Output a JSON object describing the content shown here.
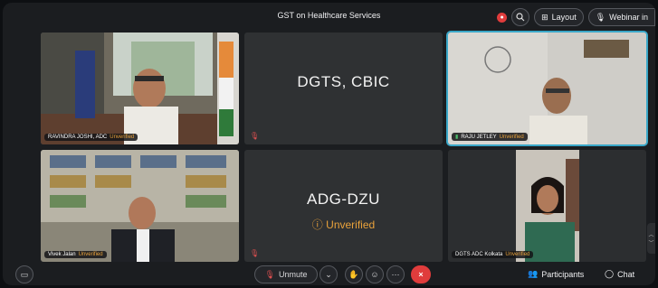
{
  "window": {
    "title": "GST on Healthcare Services"
  },
  "topbar": {
    "layout_label": "Layout",
    "webinar_label": "Webinar in"
  },
  "tiles": [
    {
      "id": "t1",
      "name": "RAVINDRA JOSHI, ADC",
      "status": "Unverified",
      "type": "video"
    },
    {
      "id": "t2",
      "label": "DGTS, CBIC",
      "type": "placeholder"
    },
    {
      "id": "t3",
      "name": "RAJU JETLEY",
      "status": "Unverified",
      "type": "video",
      "active": true
    },
    {
      "id": "t4",
      "name": "Vivek Jalan",
      "status": "Unverified",
      "type": "video"
    },
    {
      "id": "t5",
      "label": "ADG-DZU",
      "status": "Unverified",
      "type": "placeholder"
    },
    {
      "id": "t6",
      "name": "DGTS ADC Kolkata",
      "status": "Unverified",
      "type": "video"
    }
  ],
  "bottombar": {
    "unmute_label": "Unmute",
    "participants_label": "Participants",
    "chat_label": "Chat",
    "end_label": "×"
  },
  "colors": {
    "accent": "#3aa7c8",
    "warning": "#e9a23b",
    "danger": "#e03c3c",
    "tile": "#2f3133"
  }
}
